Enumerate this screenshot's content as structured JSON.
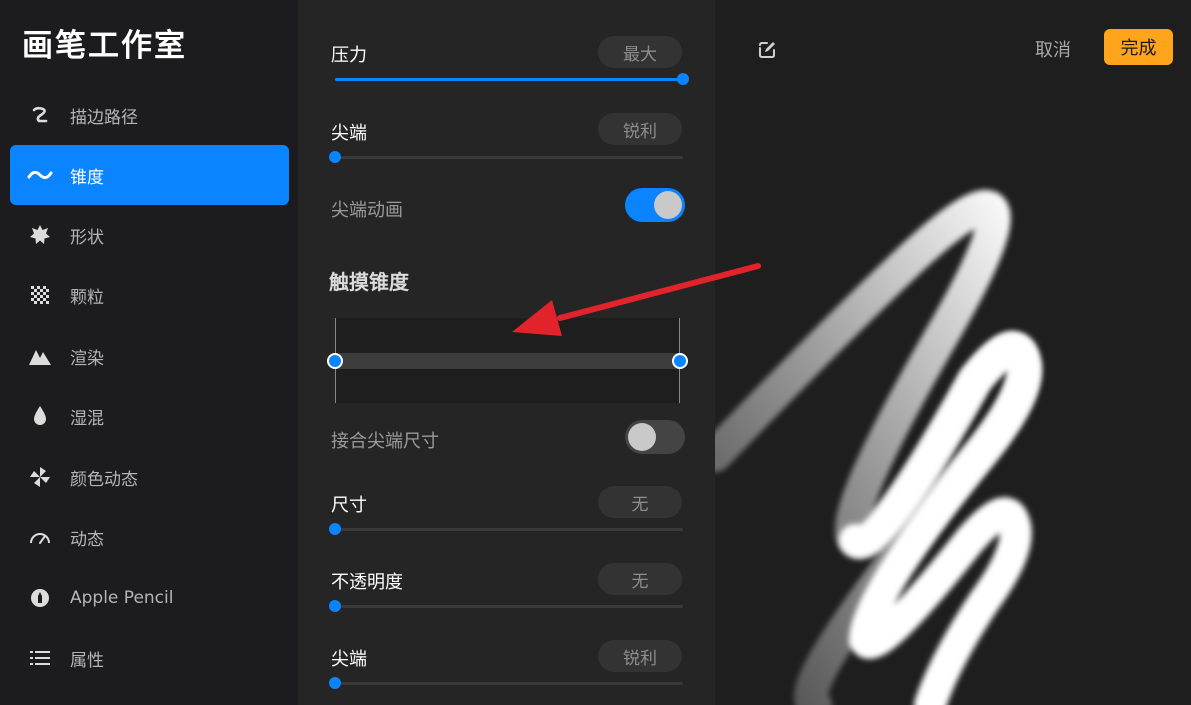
{
  "app": {
    "title": "画笔工作室"
  },
  "sidebar": {
    "items": [
      {
        "label": "描边路径",
        "icon": "stroke-path-icon",
        "active": false
      },
      {
        "label": "锥度",
        "icon": "taper-wave-icon",
        "active": true
      },
      {
        "label": "形状",
        "icon": "shape-starburst-icon",
        "active": false
      },
      {
        "label": "颗粒",
        "icon": "grain-checker-icon",
        "active": false
      },
      {
        "label": "渲染",
        "icon": "rendering-icon",
        "active": false
      },
      {
        "label": "湿混",
        "icon": "wet-mix-drop-icon",
        "active": false
      },
      {
        "label": "颜色动态",
        "icon": "color-dynamics-pinwheel-icon",
        "active": false
      },
      {
        "label": "动态",
        "icon": "dynamics-gauge-icon",
        "active": false
      },
      {
        "label": "Apple Pencil",
        "icon": "apple-pencil-icon",
        "active": false
      },
      {
        "label": "属性",
        "icon": "properties-list-icon",
        "active": false
      }
    ]
  },
  "panel": {
    "pressure": {
      "label": "压力",
      "value": "最大",
      "level": 1.0
    },
    "tip": {
      "label": "尖端",
      "value": "锐利",
      "level": 0.0
    },
    "tip_animation": {
      "label": "尖端动画",
      "on": true
    },
    "touch_taper": {
      "title": "触摸锥度",
      "start": 0.0,
      "end": 1.0
    },
    "match_tip_size": {
      "label": "接合尖端尺寸",
      "on": false
    },
    "size": {
      "label": "尺寸",
      "value": "无",
      "level": 0.0
    },
    "opacity": {
      "label": "不透明度",
      "value": "无",
      "level": 0.0
    },
    "tip2": {
      "label": "尖端",
      "value": "锐利",
      "level": 0.0
    }
  },
  "toolbar": {
    "cancel_label": "取消",
    "done_label": "完成"
  },
  "colors": {
    "accent": "#0a84ff",
    "done": "#ffa41b",
    "annotation_arrow": "#e3232b"
  }
}
